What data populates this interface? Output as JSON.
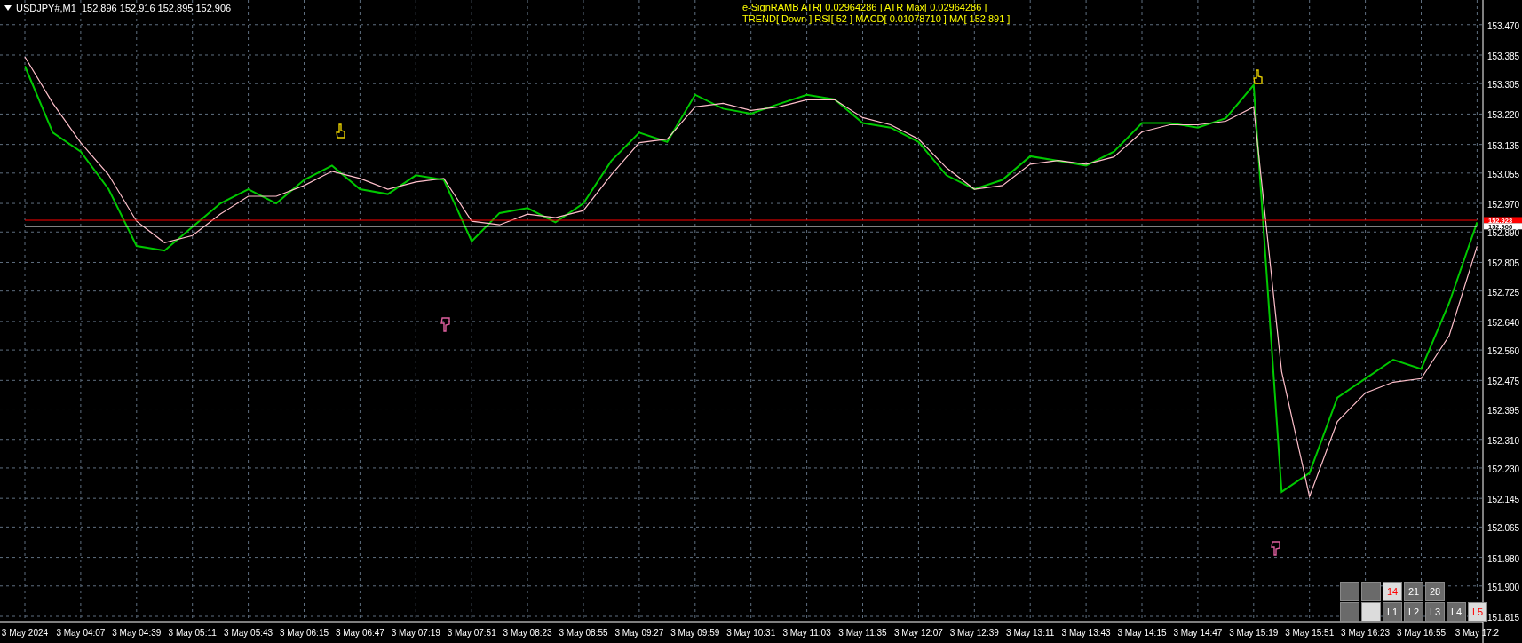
{
  "chart_title": "USDJPY#,M1  152.896 152.916 152.895 152.906",
  "indicator_lines": [
    "e-SignRAMB ATR[ 0.02964286 ] ATR Max[ 0.02964286 ]",
    "TREND[ Down ] RSI[ 52 ] MACD[ 0.01078710 ] MA[ 152.891 ]"
  ],
  "chart_data": {
    "type": "line",
    "categories": [
      "3 May 2024",
      null,
      "3 May 04:07",
      null,
      "3 May 04:39",
      null,
      "3 May 05:11",
      null,
      "3 May 05:43",
      null,
      "3 May 06:15",
      null,
      "3 May 06:47",
      null,
      "3 May 07:19",
      null,
      "3 May 07:51",
      null,
      "3 May 08:23",
      null,
      "3 May 08:55",
      null,
      "3 May 09:27",
      null,
      "3 May 09:59",
      null,
      "3 May 10:31",
      null,
      "3 May 11:03",
      null,
      "3 May 11:35",
      null,
      "3 May 12:07",
      null,
      "3 May 12:39",
      null,
      "3 May 13:11",
      null,
      "3 May 13:43",
      null,
      "3 May 14:15",
      null,
      "3 May 14:47",
      null,
      "3 May 15:19",
      null,
      "3 May 15:51",
      null,
      "3 May 16:23",
      null,
      "3 May 16:55",
      null,
      "3 May 17:2"
    ],
    "series": [
      {
        "color": "#00c800",
        "values": [
          153.354,
          153.168,
          153.115,
          153.01,
          152.851,
          152.838,
          152.904,
          152.97,
          153.01,
          152.97,
          153.036,
          153.076,
          153.01,
          152.996,
          153.049,
          153.036,
          152.864,
          152.943,
          152.957,
          152.917,
          152.97,
          153.089,
          153.168,
          153.142,
          153.274,
          153.235,
          153.221,
          153.248,
          153.274,
          153.261,
          153.195,
          153.182,
          153.142,
          153.049,
          153.01,
          153.036,
          153.102,
          153.089,
          153.076,
          153.115,
          153.195,
          153.195,
          153.182,
          153.208,
          153.301,
          152.163,
          152.216,
          152.427,
          152.48,
          152.533,
          152.507,
          152.692,
          152.917
        ]
      },
      {
        "color": "#ffc0cb",
        "values": [
          153.38,
          153.25,
          153.14,
          153.05,
          152.92,
          152.86,
          152.88,
          152.94,
          152.99,
          152.99,
          153.02,
          153.06,
          153.04,
          153.01,
          153.03,
          153.04,
          152.92,
          152.91,
          152.94,
          152.93,
          152.95,
          153.05,
          153.14,
          153.15,
          153.24,
          153.25,
          153.23,
          153.24,
          153.26,
          153.26,
          153.21,
          153.19,
          153.15,
          153.07,
          153.01,
          153.02,
          153.08,
          153.09,
          153.08,
          153.1,
          153.17,
          153.19,
          153.19,
          153.2,
          153.24,
          152.5,
          152.15,
          152.36,
          152.44,
          152.47,
          152.48,
          152.6,
          152.85
        ]
      },
      {
        "name": "152.923",
        "color": "#ff0000",
        "values": [
          152.923,
          152.923,
          152.923,
          152.923,
          152.923,
          152.923,
          152.923,
          152.923,
          152.923,
          152.923,
          152.923,
          152.923,
          152.923,
          152.923,
          152.923,
          152.923,
          152.923,
          152.923,
          152.923,
          152.923,
          152.923,
          152.923,
          152.923,
          152.923,
          152.923,
          152.923,
          152.923,
          152.923,
          152.923,
          152.923,
          152.923,
          152.923,
          152.923,
          152.923,
          152.923,
          152.923,
          152.923,
          152.923,
          152.923,
          152.923,
          152.923,
          152.923,
          152.923,
          152.923,
          152.923,
          152.923,
          152.923,
          152.923,
          152.923,
          152.923,
          152.923,
          152.923,
          152.923
        ]
      },
      {
        "name": "152.906",
        "color": "#ffffff",
        "values": [
          152.906,
          152.906,
          152.906,
          152.906,
          152.906,
          152.906,
          152.906,
          152.906,
          152.906,
          152.906,
          152.906,
          152.906,
          152.906,
          152.906,
          152.906,
          152.906,
          152.906,
          152.906,
          152.906,
          152.906,
          152.906,
          152.906,
          152.906,
          152.906,
          152.906,
          152.906,
          152.906,
          152.906,
          152.906,
          152.906,
          152.906,
          152.906,
          152.906,
          152.906,
          152.906,
          152.906,
          152.906,
          152.906,
          152.906,
          152.906,
          152.906,
          152.906,
          152.906,
          152.906,
          152.906,
          152.906,
          152.906,
          152.906,
          152.906,
          152.906,
          152.906,
          152.906,
          152.906
        ]
      }
    ],
    "ylim": [
      151.815,
      153.539
    ],
    "yticks": [
      {
        "value": 153.47,
        "label": "153.470"
      },
      {
        "value": 153.385,
        "label": "153.385"
      },
      {
        "value": 153.305,
        "label": "153.305"
      },
      {
        "value": 153.22,
        "label": "153.220"
      },
      {
        "value": 153.135,
        "label": "153.135"
      },
      {
        "value": 153.055,
        "label": "153.055"
      },
      {
        "value": 152.97,
        "label": "152.970"
      },
      {
        "value": 152.89,
        "label": "152.890"
      },
      {
        "value": 152.805,
        "label": "152.805"
      },
      {
        "value": 152.725,
        "label": "152.725"
      },
      {
        "value": 152.64,
        "label": "152.640"
      },
      {
        "value": 152.56,
        "label": "152.560"
      },
      {
        "value": 152.475,
        "label": "152.475"
      },
      {
        "value": 152.395,
        "label": "152.395"
      },
      {
        "value": 152.31,
        "label": "152.310"
      },
      {
        "value": 152.23,
        "label": "152.230"
      },
      {
        "value": 152.145,
        "label": "152.145"
      },
      {
        "value": 152.065,
        "label": "152.065"
      },
      {
        "value": 151.98,
        "label": "151.980"
      },
      {
        "value": 151.9,
        "label": "151.900"
      },
      {
        "value": 151.815,
        "label": "151.815"
      }
    ],
    "grid": true
  },
  "period_buttons": [
    [
      {
        "selected": false
      },
      {
        "selected": false
      },
      {
        "label": "14",
        "selected": true
      },
      {
        "label": "21",
        "selected": false
      },
      {
        "label": "28",
        "selected": false
      }
    ],
    [
      {
        "selected": false
      },
      {
        "selected": true
      },
      {
        "label": "L1",
        "selected": false
      },
      {
        "label": "L2",
        "selected": false
      },
      {
        "label": "L3",
        "selected": false
      },
      {
        "label": "L4",
        "selected": false
      },
      {
        "label": "L5",
        "selected": true
      }
    ]
  ]
}
